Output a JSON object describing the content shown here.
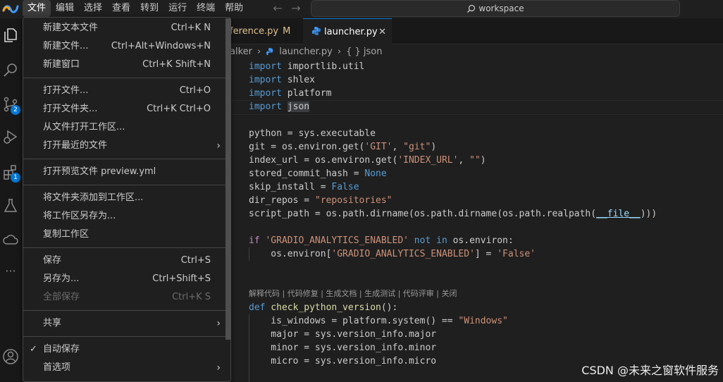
{
  "menubar": [
    "文件",
    "编辑",
    "选择",
    "查看",
    "转到",
    "运行",
    "终端",
    "帮助"
  ],
  "search": {
    "text": "workspace"
  },
  "activity": {
    "scm_badge": "2",
    "ext_badge": "1"
  },
  "tabs": [
    {
      "label": "ference.py",
      "modified": "M"
    },
    {
      "label": "launcher.py",
      "close": "✕"
    }
  ],
  "breadcrumb": {
    "folder": "alker",
    "file": "launcher.py",
    "symbol": "{ } json"
  },
  "code": {
    "l1": {
      "kw": "import",
      "rest": " importlib.util"
    },
    "l2": {
      "kw": "import",
      "rest": " shlex"
    },
    "l3": {
      "kw": "import",
      "rest": " platform"
    },
    "l4": {
      "kw": "import",
      "rest": "json"
    },
    "l6": {
      "a": "python = sys.executable"
    },
    "l7": {
      "a": "git = os.environ.get(",
      "s1": "'GIT'",
      "b": ", ",
      "s2": "\"git\"",
      "c": ")"
    },
    "l8": {
      "a": "index_url = os.environ.get(",
      "s1": "'INDEX_URL'",
      "b": ", ",
      "s2": "\"\"",
      "c": ")"
    },
    "l9": {
      "a": "stored_commit_hash = ",
      "k": "None"
    },
    "l10": {
      "a": "skip_install = ",
      "k": "False"
    },
    "l11": {
      "a": "dir_repos = ",
      "s": "\"repositories\""
    },
    "l12": {
      "a": "script_path = os.path.dirname(os.path.dirname(os.path.realpath(",
      "v": "__file__",
      "c": ")))"
    },
    "l14": {
      "k": "if",
      "s": " 'GRADIO_ANALYTICS_ENABLED'",
      "n": " not in",
      "c": " os.environ:"
    },
    "l15": {
      "a": "    os.environ[",
      "s1": "'GRADIO_ANALYTICS_ENABLED'",
      "b": "] = ",
      "s2": "'False'"
    },
    "codelens": "解释代码 | 代码修复 | 生成文档 | 生成测试 | 代码评审 | 关闭",
    "l18": {
      "k": "def",
      "f": " check_python_version",
      "c": "():"
    },
    "l19": {
      "a": "    is_windows = platform.system() == ",
      "s": "\"Windows\""
    },
    "l20": {
      "a": "    major = sys.version_info.major"
    },
    "l21": {
      "a": "    minor = sys.version_info.minor"
    },
    "l22": {
      "a": "    micro = sys.version_info.micro"
    }
  },
  "file_menu": {
    "new_text_file": {
      "label": "新建文本文件",
      "kb": "Ctrl+K N"
    },
    "new_file": {
      "label": "新建文件...",
      "kb": "Ctrl+Alt+Windows+N"
    },
    "new_window": {
      "label": "新建窗口",
      "kb": "Ctrl+K Shift+N"
    },
    "open_file": {
      "label": "打开文件...",
      "kb": "Ctrl+O"
    },
    "open_folder": {
      "label": "打开文件夹...",
      "kb": "Ctrl+K Ctrl+O"
    },
    "open_workspace": {
      "label": "从文件打开工作区..."
    },
    "open_recent": {
      "label": "打开最近的文件"
    },
    "open_preview": {
      "label": "打开预览文件 preview.yml"
    },
    "add_folder": {
      "label": "将文件夹添加到工作区..."
    },
    "save_workspace_as": {
      "label": "将工作区另存为..."
    },
    "duplicate_workspace": {
      "label": "复制工作区"
    },
    "save": {
      "label": "保存",
      "kb": "Ctrl+S"
    },
    "save_as": {
      "label": "另存为...",
      "kb": "Ctrl+Shift+S"
    },
    "save_all": {
      "label": "全部保存",
      "kb": "Ctrl+K S"
    },
    "share": {
      "label": "共享"
    },
    "auto_save": {
      "label": "自动保存",
      "check": "✓"
    },
    "preferences": {
      "label": "首选项"
    },
    "submenu_arrow": "›"
  },
  "watermark": "CSDN @未来之窗软件服务",
  "colors": {
    "accent": "#0078d4",
    "background": "#1f1f1f",
    "menu_bg": "#1f1f1f"
  }
}
